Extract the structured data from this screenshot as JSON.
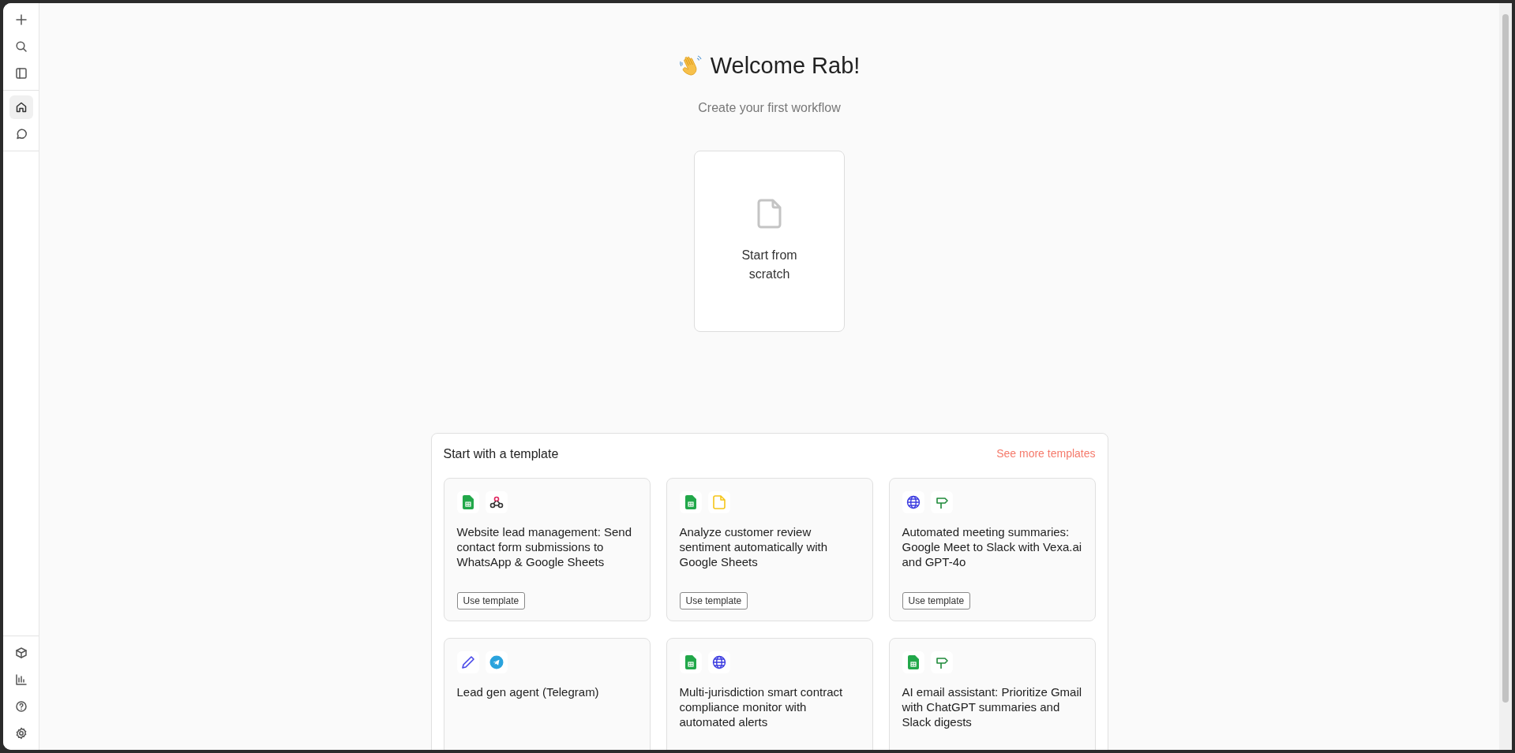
{
  "sidebar": {
    "top_items": [
      {
        "kind": "plus"
      },
      {
        "kind": "search"
      },
      {
        "kind": "panel"
      }
    ],
    "nav_items": [
      {
        "kind": "home",
        "selected": true
      },
      {
        "kind": "chat",
        "selected": false
      }
    ],
    "bottom_items": [
      {
        "kind": "box"
      },
      {
        "kind": "chart"
      },
      {
        "kind": "help"
      },
      {
        "kind": "settings"
      }
    ]
  },
  "heading": "Welcome Rab!",
  "subtitle": "Create your first workflow",
  "start_card": {
    "label": "Start from scratch"
  },
  "templates": {
    "title": "Start with a template",
    "link": "See more templates",
    "cards": [
      {
        "apps": [
          {
            "kind": "sheets"
          },
          {
            "kind": "webhook"
          }
        ],
        "title": "Website lead management: Send contact form submissions to WhatsApp & Google Sheets",
        "button": "Use template"
      },
      {
        "apps": [
          {
            "kind": "sheets"
          },
          {
            "kind": "note"
          }
        ],
        "title": "Analyze customer review sentiment automatically with Google Sheets",
        "button": "Use template"
      },
      {
        "apps": [
          {
            "kind": "globe"
          },
          {
            "kind": "signpost"
          }
        ],
        "title": "Automated meeting summaries: Google Meet to Slack with Vexa.ai and GPT-4o",
        "button": "Use template"
      },
      {
        "apps": [
          {
            "kind": "pencil"
          },
          {
            "kind": "telegram"
          }
        ],
        "title": "Lead gen agent (Telegram)"
      },
      {
        "apps": [
          {
            "kind": "sheets"
          },
          {
            "kind": "globe"
          }
        ],
        "title": "Multi-jurisdiction smart contract compliance monitor with automated alerts"
      },
      {
        "apps": [
          {
            "kind": "sheets"
          },
          {
            "kind": "signpost"
          }
        ],
        "title": "AI email assistant: Prioritize Gmail with ChatGPT summaries and Slack digests"
      }
    ]
  }
}
